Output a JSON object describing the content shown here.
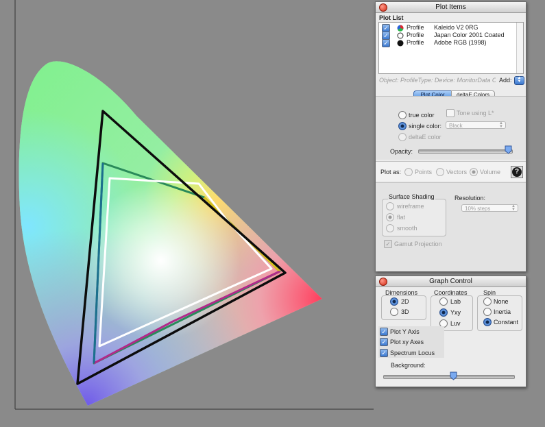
{
  "plot_items": {
    "title": "Plot Items",
    "list_header": "Plot List",
    "items": [
      {
        "type": "Profile",
        "name": "Kaleido V2 0RG",
        "swatch": "rgb"
      },
      {
        "type": "Profile",
        "name": "Japan Color 2001 Coated",
        "swatch": "white"
      },
      {
        "type": "Profile",
        "name": "Adobe RGB (1998)",
        "swatch": "black"
      }
    ],
    "info_text": "Object: ProfileType: Device: MonitorData C",
    "add_label": "Add:",
    "tabs": {
      "plot_color": "Plot Color",
      "deltae_colors": "deltaE Colors"
    },
    "color_options": {
      "true_color": "true color",
      "single_color": "single color:",
      "deltae_color": "deltaE color"
    },
    "tone_using": "Tone using L*",
    "single_color_value": "Black",
    "opacity_label": "Opacity:",
    "plot_as": {
      "label": "Plot as:",
      "points": "Points",
      "vectors": "Vectors",
      "volume": "Volume"
    },
    "help": "?",
    "surface_shading": {
      "title": "Surface Shading",
      "wireframe": "wireframe",
      "flat": "flat",
      "smooth": "smooth"
    },
    "resolution": {
      "label": "Resolution:",
      "value": "10% steps"
    },
    "gamut_projection": "Gamut Projection"
  },
  "graph_control": {
    "title": "Graph Control",
    "dimensions": {
      "title": "Dimensions",
      "d2": "2D",
      "d3": "3D"
    },
    "coordinates": {
      "title": "Coordinates",
      "lab": "Lab",
      "yxy": "Yxy",
      "luv": "Luv"
    },
    "spin": {
      "title": "Spin",
      "none": "None",
      "inertia": "Inertia",
      "constant": "Constant"
    },
    "checkboxes": {
      "plot_y_axis": "Plot Y Axis",
      "plot_xy_axes": "Plot xy Axes",
      "spectrum_locus": "Spectrum Locus"
    },
    "background_label": "Background:"
  }
}
